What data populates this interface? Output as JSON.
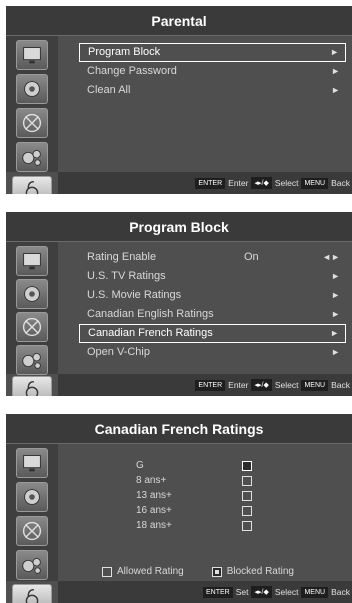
{
  "panels": [
    {
      "title": "Parental",
      "items": [
        {
          "label": "Program Block",
          "selected": true
        },
        {
          "label": "Change Password"
        },
        {
          "label": "Clean All"
        }
      ],
      "arrow": "►"
    },
    {
      "title": "Program Block",
      "items": [
        {
          "label": "Rating Enable",
          "value": "On",
          "arrow": "◄►"
        },
        {
          "label": "U.S. TV Ratings",
          "arrow": "►"
        },
        {
          "label": "U.S. Movie Ratings",
          "arrow": "►"
        },
        {
          "label": "Canadian English Ratings",
          "arrow": "►"
        },
        {
          "label": "Canadian French Ratings",
          "arrow": "►",
          "selected": true
        },
        {
          "label": "Open V-Chip",
          "arrow": "►"
        }
      ]
    },
    {
      "title": "Canadian French Ratings",
      "ratings": [
        {
          "label": "G",
          "blocked": true
        },
        {
          "label": "8 ans+"
        },
        {
          "label": "13 ans+"
        },
        {
          "label": "16 ans+"
        },
        {
          "label": "18 ans+"
        }
      ],
      "legend": {
        "allowed": "Allowed Rating",
        "blocked": "Blocked Rating"
      }
    }
  ],
  "bottom": {
    "enter_key": "ENTER",
    "enter_label": "Enter",
    "set_label": "Set",
    "nav_key": "◂▸/◆",
    "select_label": "Select",
    "menu_key": "MENU",
    "back_label": "Back"
  },
  "icons": [
    "picture-icon",
    "sound-icon",
    "channel-icon",
    "setup-icon",
    "parental-lock-icon"
  ]
}
